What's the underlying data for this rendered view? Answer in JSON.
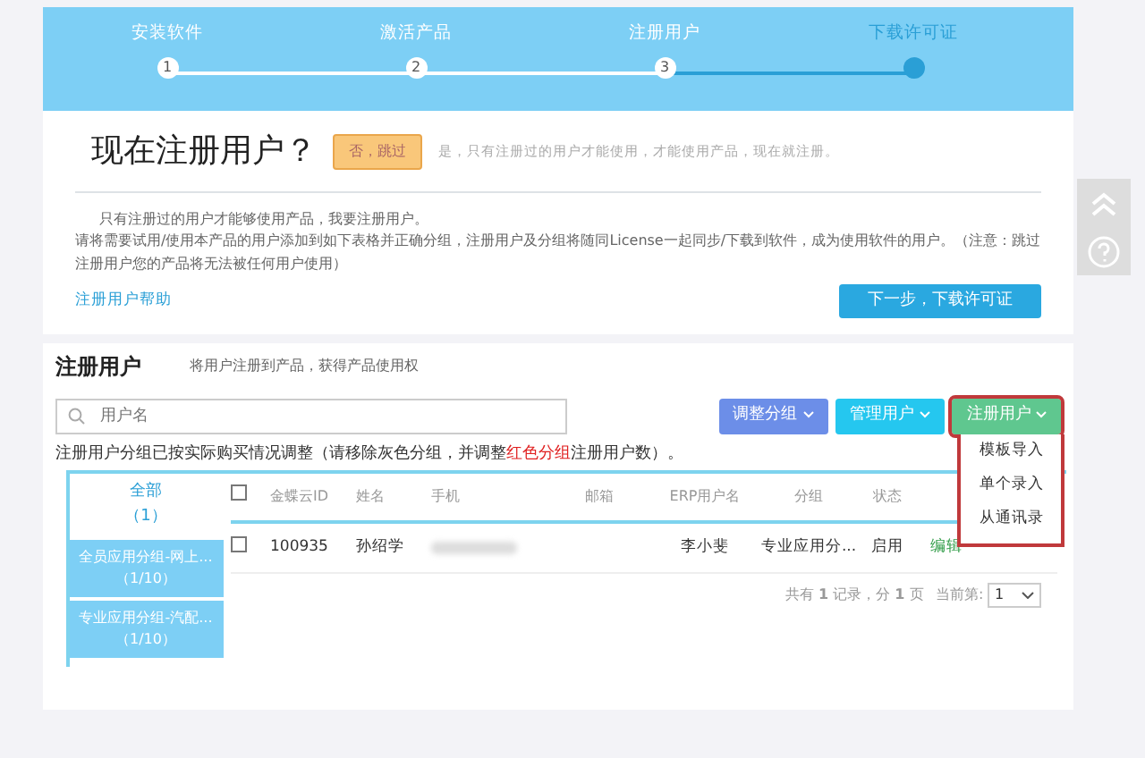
{
  "steps": [
    {
      "label": "安装软件",
      "number": "1",
      "current": false
    },
    {
      "label": "激活产品",
      "number": "2",
      "current": false
    },
    {
      "label": "注册用户",
      "number": "3",
      "current": false
    },
    {
      "label": "下载许可证",
      "current": true
    }
  ],
  "question": {
    "title": "现在注册用户？",
    "skip_button": "否，跳过",
    "hint": "是，只有注册过的用户才能使用，才能使用产品，现在就注册。"
  },
  "intro": [
    "只有注册过的用户才能够使用产品，我要注册用户。",
    "请将需要试用/使用本产品的用户添加到如下表格并正确分组，注册用户及分组将随同License一起同步/下载到软件，成为使用软件的用户。（注意：跳过注册用户您的产品将无法被任何用户使用）"
  ],
  "help_link": "注册用户帮助",
  "next_button": "下一步，下载许可证",
  "section": {
    "title": "注册用户",
    "subtitle": "将用户注册到产品，获得产品使用权"
  },
  "search": {
    "placeholder": "用户名"
  },
  "toolbar": [
    {
      "label": "调整分组",
      "kind": "adjust"
    },
    {
      "label": "管理用户",
      "kind": "manage"
    },
    {
      "label": "注册用户",
      "kind": "register",
      "expanded": true
    }
  ],
  "register_menu": [
    "模板导入",
    "单个录入",
    "从通讯录"
  ],
  "notice": "注册用户分组已按实际购买情况调整（请移除灰色分组，并调整**红色分组**注册用户数）。",
  "groups": [
    {
      "name": "全部",
      "count": "（1）",
      "selected": true
    },
    {
      "name": "全员应用分组-网上...",
      "count": "（1/10）",
      "selected": false
    },
    {
      "name": "专业应用分组-汽配...",
      "count": "（1/10）",
      "selected": false
    }
  ],
  "table": {
    "select_all": false,
    "columns": [
      "金蝶云ID",
      "姓名",
      "手机",
      "邮箱",
      "ERP用户名",
      "分组",
      "状态"
    ],
    "rows": [
      {
        "checked": false,
        "cells": [
          "100935",
          "孙绍学",
          "",
          "",
          "李小斐",
          "专业应用分...",
          "启用"
        ],
        "action": "编辑"
      }
    ]
  },
  "pagination": {
    "summary": "共有 **1** 记录，分 **1** 页",
    "current_label": "当前第:",
    "page": "1"
  }
}
